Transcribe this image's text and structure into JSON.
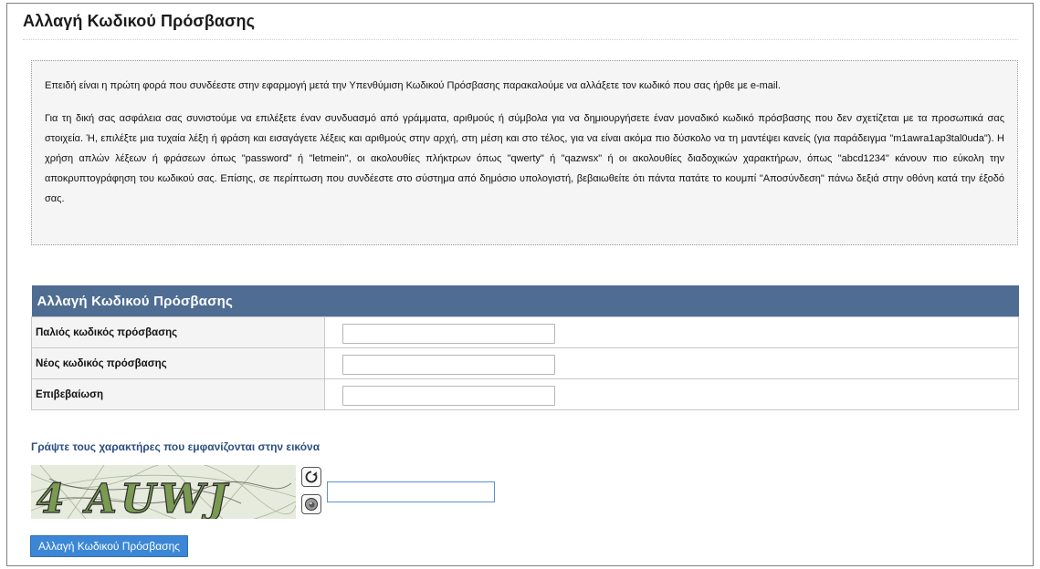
{
  "page": {
    "title": "Αλλαγή Κωδικού Πρόσβασης"
  },
  "info": {
    "paragraph1": "Επειδή είναι η πρώτη φορά που συνδέεστε στην εφαρμογή μετά την Υπενθύμιση Κωδικού Πρόσβασης παρακαλούμε να αλλάξετε τον κωδικό που σας ήρθε με e-mail.",
    "paragraph2": "Για τη δική σας ασφάλεια σας συνιστούμε να επιλέξετε έναν συνδυασμό από γράμματα, αριθμούς ή σύμβολα για να δημιουργήσετε έναν μοναδικό κωδικό πρόσβασης που δεν σχετίζεται με τα προσωπικά σας στοιχεία. Ή, επιλέξτε μια τυχαία λέξη ή φράση και εισαγάγετε λέξεις και αριθμούς στην αρχή, στη μέση και στο τέλος, για να είναι ακόμα πιο δύσκολο να τη μαντέψει κανείς (για παράδειγμα \"m1awra1ap3tal0uda\"). Η χρήση απλών λέξεων ή φράσεων όπως \"password\" ή \"letmein\", οι ακολουθίες πλήκτρων όπως \"qwerty\" ή \"qazwsx\" ή οι ακολουθίες διαδοχικών χαρακτήρων, όπως \"abcd1234\" κάνουν πιο εύκολη την αποκρυπτογράφηση του κωδικού σας. Επίσης, σε περίπτωση που συνδέεστε στο σύστημα από δημόσιο υπολογιστή, βεβαιωθείτε ότι πάντα πατάτε το κουμπί \"Αποσύνδεση\" πάνω δεξιά στην οθόνη κατά την έξοδό σας."
  },
  "form": {
    "header": "Αλλαγή Κωδικού Πρόσβασης",
    "old_password_label": "Παλιός κωδικός πρόσβασης",
    "old_password_value": "",
    "new_password_label": "Νέος κωδικός πρόσβασης",
    "new_password_value": "",
    "confirm_label": "Επιβεβαίωση",
    "confirm_value": ""
  },
  "captcha": {
    "label": "Γράψτε τους χαρακτήρες που εμφανίζονται στην εικόνα",
    "image_text": "4 AUWJ",
    "input_value": "",
    "refresh_icon": "refresh-icon",
    "audio_icon": "audio-icon"
  },
  "submit": {
    "label": "Αλλαγή Κωδικού Πρόσβασης"
  },
  "colors": {
    "table_header_bg": "#4f6d93",
    "link_blue": "#2d4f82",
    "button_blue": "#3b87d6",
    "info_bg": "#f5f5f5"
  }
}
